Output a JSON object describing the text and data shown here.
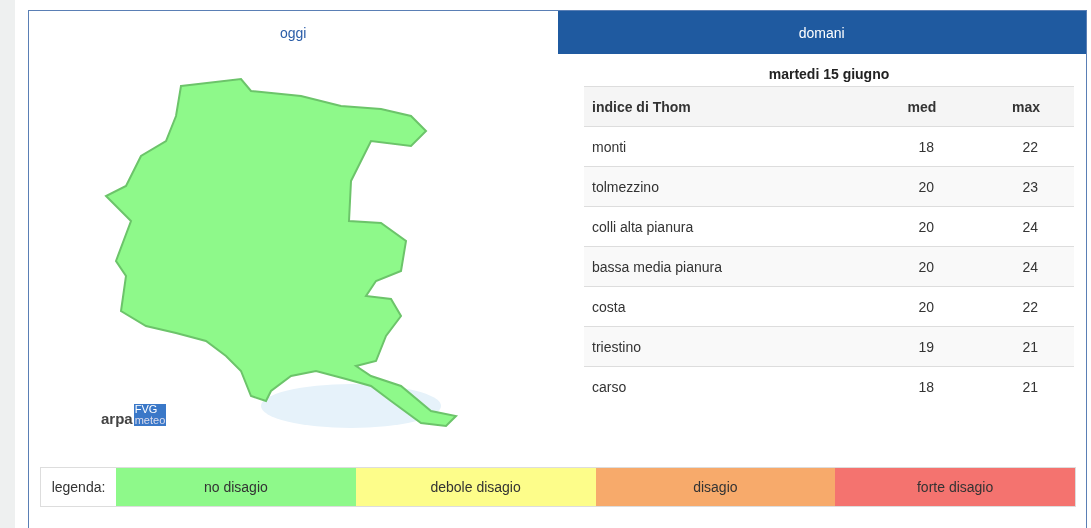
{
  "tabs": [
    {
      "label": "oggi",
      "selected": true
    },
    {
      "label": "domani",
      "selected": false
    }
  ],
  "logo": {
    "left": "arpa",
    "right_top": "FVG",
    "right_bottom": "meteo"
  },
  "table": {
    "title": "martedi 15 giugno",
    "columns": [
      "indice di Thom",
      "med",
      "max"
    ],
    "rows": [
      [
        "monti",
        "18",
        "22"
      ],
      [
        "tolmezzino",
        "20",
        "23"
      ],
      [
        "colli alta pianura",
        "20",
        "24"
      ],
      [
        "bassa media pianura",
        "20",
        "24"
      ],
      [
        "costa",
        "20",
        "22"
      ],
      [
        "triestino",
        "19",
        "21"
      ],
      [
        "carso",
        "18",
        "21"
      ]
    ]
  },
  "legend": {
    "label": "legenda:",
    "items": [
      {
        "label": "no disagio",
        "color": "#8ef98a"
      },
      {
        "label": "debole disagio",
        "color": "#fdfd8a"
      },
      {
        "label": "disagio",
        "color": "#f7aa6b"
      },
      {
        "label": "forte disagio",
        "color": "#f4736f"
      }
    ]
  }
}
